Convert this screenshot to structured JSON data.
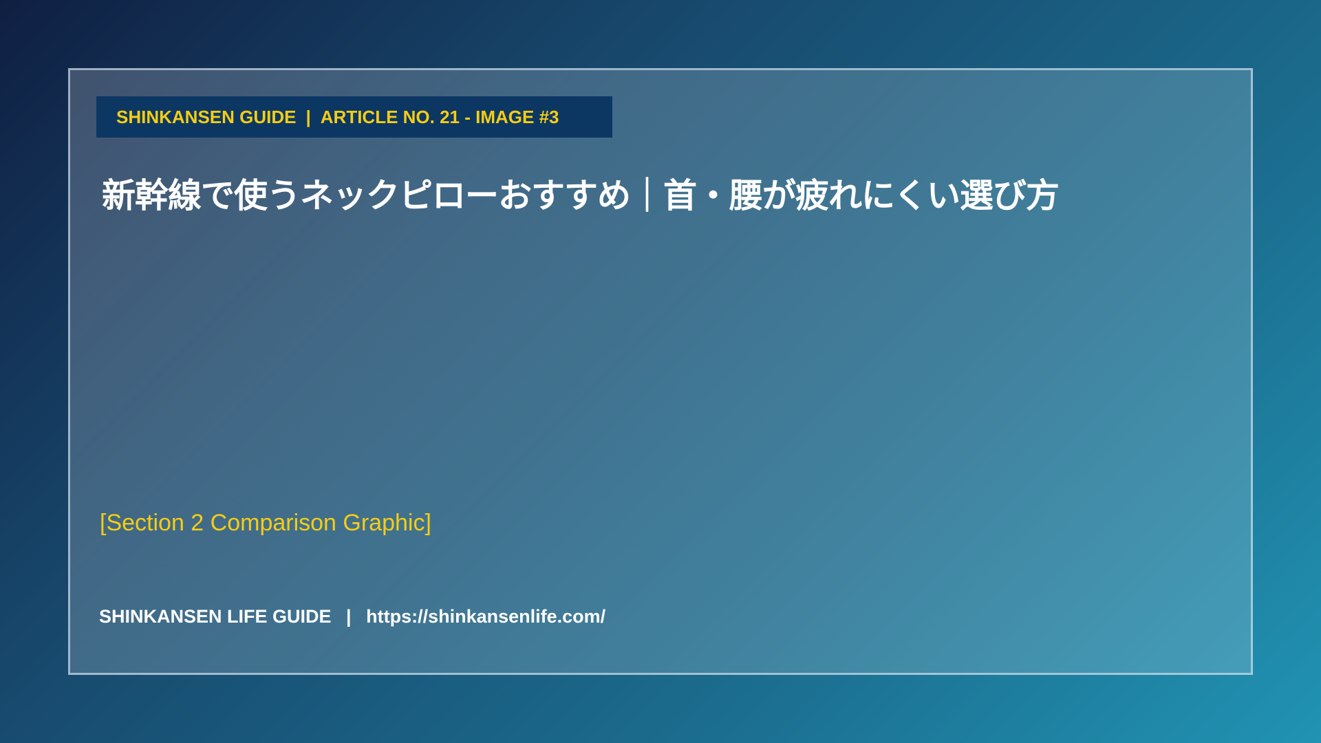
{
  "header": {
    "series": "SHINKANSEN GUIDE",
    "separator": "|",
    "article": "ARTICLE NO. 21 - IMAGE #3",
    "colors": {
      "badge_background": "#0d3763",
      "badge_text": "#f5cd14"
    }
  },
  "title": "新幹線で使うネックピローおすすめ｜首・腰が疲れにくい選び方",
  "placeholder": "[Section 2 Comparison Graphic]",
  "footer": {
    "brand": "SHINKANSEN LIFE GUIDE",
    "separator": "|",
    "url": "https://shinkansenlife.com/"
  },
  "colors": {
    "accent": "#f5cd14",
    "text": "#ffffff",
    "background_start": "#0f1f42",
    "background_end": "#2193b3"
  }
}
